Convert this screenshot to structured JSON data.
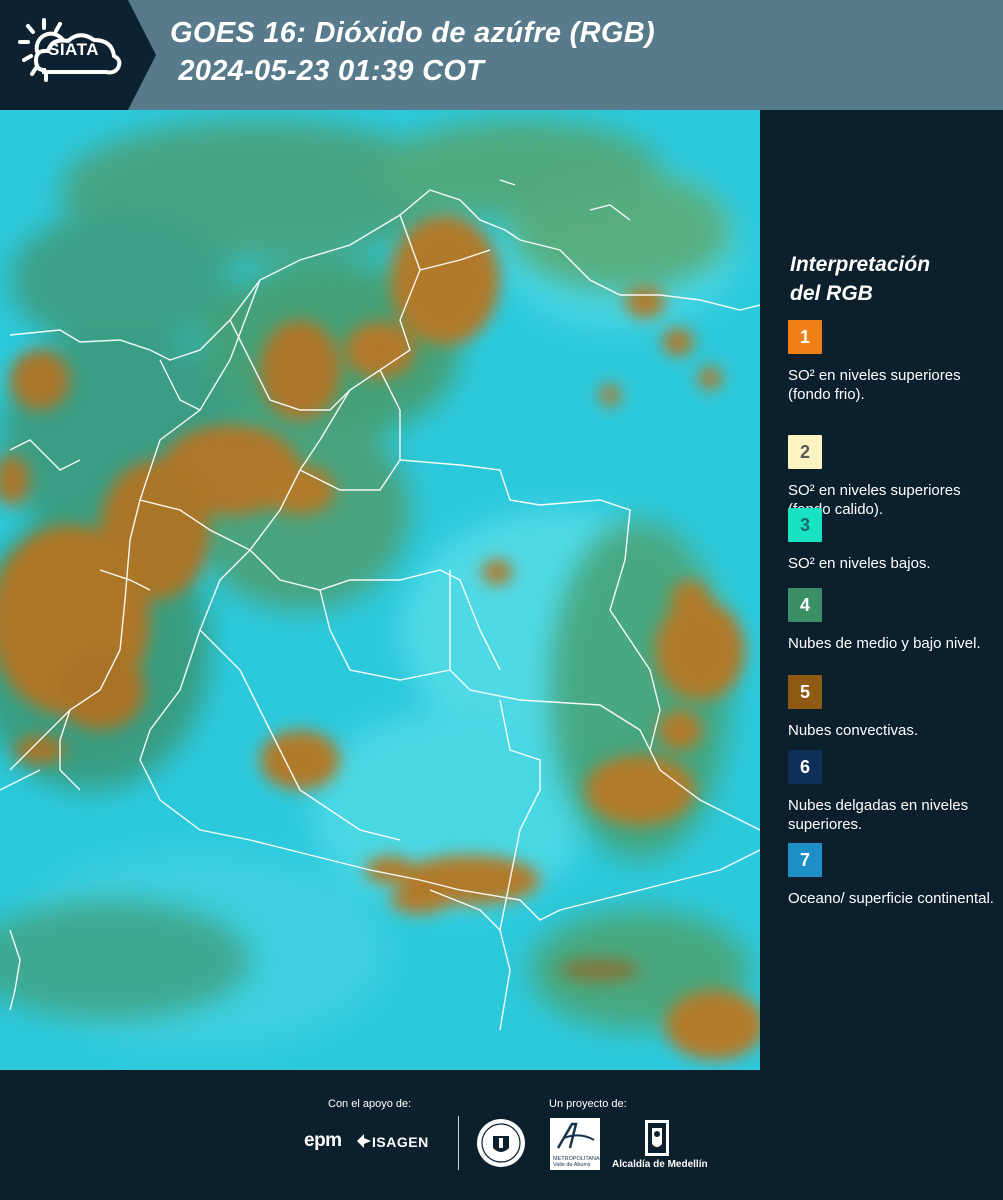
{
  "header": {
    "logo_text": "SIATA",
    "title_line1": "GOES 16: Dióxido de azúfre (RGB)",
    "title_line2": " 2024-05-23 01:39 COT"
  },
  "legend": {
    "title_line1": "Interpretación",
    "title_line2": "del RGB",
    "items": [
      {
        "number": "1",
        "color": "#f07f16",
        "text_color": "#ffffff",
        "label": "SO² en niveles superiores (fondo frio)."
      },
      {
        "number": "2",
        "color": "#fbf3c2",
        "text_color": "#5a5a5a",
        "label": "SO² en niveles superiores (fondo calido)."
      },
      {
        "number": "3",
        "color": "#18e3c4",
        "text_color": "#1b6b66",
        "label": "SO² en niveles bajos."
      },
      {
        "number": "4",
        "color": "#3a8f64",
        "text_color": "#ffffff",
        "label": "Nubes de medio y bajo nivel."
      },
      {
        "number": "5",
        "color": "#8f5a14",
        "text_color": "#ffffff",
        "label": "Nubes convectivas."
      },
      {
        "number": "6",
        "color": "#0e2f5a",
        "text_color": "#ffffff",
        "label": "Nubes delgadas en niveles superiores."
      },
      {
        "number": "7",
        "color": "#1e8fc6",
        "text_color": "#ffffff",
        "label": "Oceano/ superficie continental."
      }
    ]
  },
  "footer": {
    "support_label": "Con el apoyo de:",
    "project_label": "Un proyecto de:",
    "sponsor1": "epm",
    "sponsor2": "ISAGEN",
    "area_text_line1": "METROPOLITANA",
    "area_text_line2": "Valle de Aburrá",
    "alcaldia": "Alcaldía de Medellín"
  },
  "colors": {
    "background": "#0c1f2c",
    "header_bar": "#577b8a",
    "map_cyan": "#2ec8dc",
    "cloud_orange": "#b07a2a",
    "cloud_green": "#4e9a6a"
  }
}
